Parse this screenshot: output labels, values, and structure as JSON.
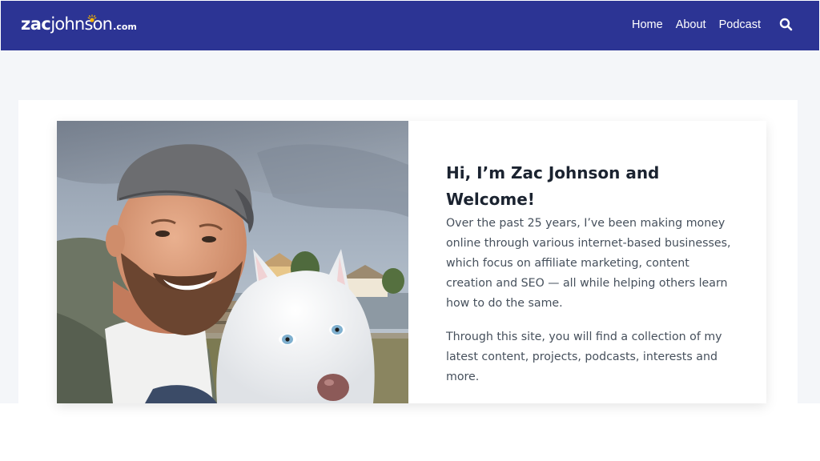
{
  "brand": {
    "logo_part1": "zac",
    "logo_part2": "johnson",
    "logo_suffix": ".com",
    "color_header": "#2c3494",
    "color_sun": "#f5b400"
  },
  "nav": {
    "items": [
      {
        "label": "Home"
      },
      {
        "label": "About"
      },
      {
        "label": "Podcast"
      }
    ],
    "search_icon": "search-icon"
  },
  "hero": {
    "headline": "Hi, I’m Zac Johnson and Welcome!",
    "paragraph1": "Over the past 25 years, I’ve been making money online through various internet-based businesses, which focus on affiliate marketing, content creation and SEO — all while helping others learn how to do the same.",
    "paragraph2": "Through this site, you will find a collection of my latest content, projects, podcasts, interests and more."
  }
}
